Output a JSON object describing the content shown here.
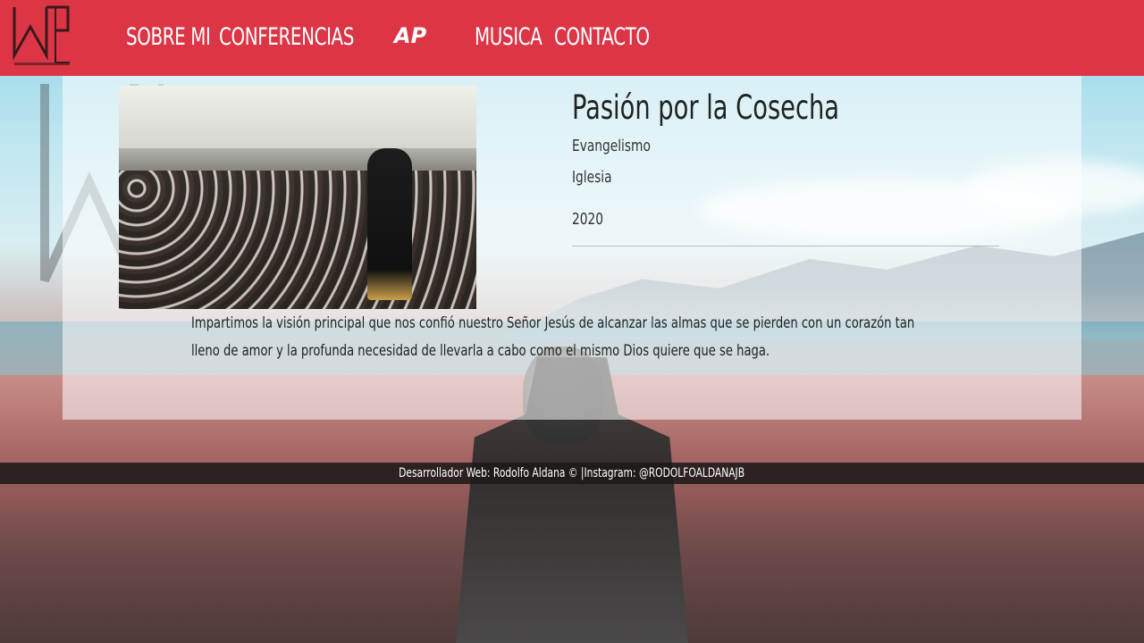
{
  "header": {
    "logo_alt": "AP",
    "nav": {
      "sobre_mi": "SOBRE MI",
      "conferencias": "CONFERENCIAS",
      "ap": "AP",
      "musica": "MUSICA",
      "contacto": "CONTACTO"
    }
  },
  "conference": {
    "title": "Pasión por la Cosecha",
    "category": "Evangelismo",
    "venue": "Iglesia",
    "year": "2020",
    "description": "Impartimos la visión principal que nos confió nuestro Señor Jesús de alcanzar las almas que se pierden con un corazón tan lleno de amor y la profunda necesidad de llevarla a cabo como el mismo Dios quiere que se haga."
  },
  "footer": {
    "credit": "Desarrollador Web: Rodolfo Aldana © |Instagram: @RODOLFOALDANAJB"
  },
  "colors": {
    "header_bg": "#dc3545",
    "panel_bg": "rgba(255,255,255,0.55)"
  }
}
